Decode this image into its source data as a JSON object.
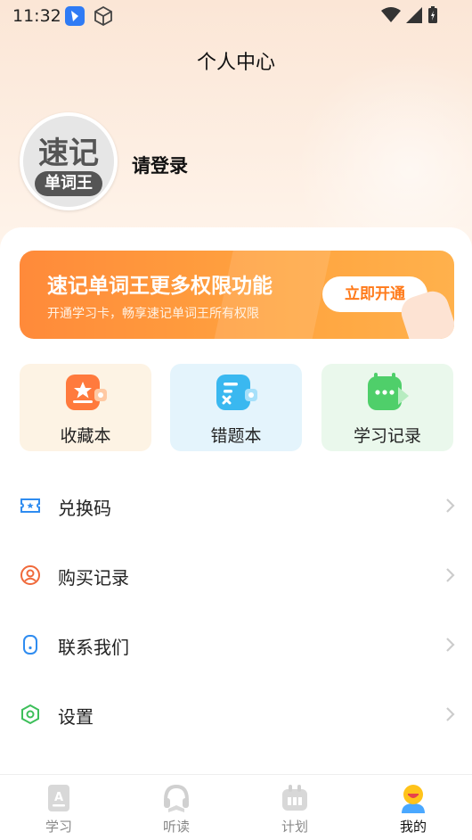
{
  "status_bar": {
    "time": "11:32"
  },
  "header": {
    "title": "个人中心"
  },
  "profile": {
    "avatar_big": "速记",
    "avatar_small": "单词王",
    "login_text": "请登录"
  },
  "banner": {
    "title": "速记单词王更多权限功能",
    "subtitle": "开通学习卡，畅享速记单词王所有权限",
    "button_label": "立即开通"
  },
  "quick_entries": [
    {
      "label": "收藏本",
      "icon": "bookmark-icon",
      "color": "#ff7a3d"
    },
    {
      "label": "错题本",
      "icon": "wrong-book-icon",
      "color": "#3ab8f0"
    },
    {
      "label": "学习记录",
      "icon": "study-record-icon",
      "color": "#4fcf6a"
    }
  ],
  "menu": [
    {
      "label": "兑换码",
      "icon": "ticket-icon",
      "color": "#2f8cf0"
    },
    {
      "label": "购买记录",
      "icon": "user-circle-icon",
      "color": "#f0693a"
    },
    {
      "label": "联系我们",
      "icon": "phone-icon",
      "color": "#2f8cf0"
    },
    {
      "label": "设置",
      "icon": "settings-icon",
      "color": "#3dbf5a"
    }
  ],
  "tabbar": {
    "active": "我的",
    "items": [
      {
        "label": "学习",
        "icon": "study-tab-icon"
      },
      {
        "label": "听读",
        "icon": "listen-tab-icon"
      },
      {
        "label": "计划",
        "icon": "plan-tab-icon"
      },
      {
        "label": "我的",
        "icon": "mine-tab-icon"
      }
    ]
  },
  "colors": {
    "accent": "#ff8a3a",
    "background_top": "#fbe6d6"
  }
}
